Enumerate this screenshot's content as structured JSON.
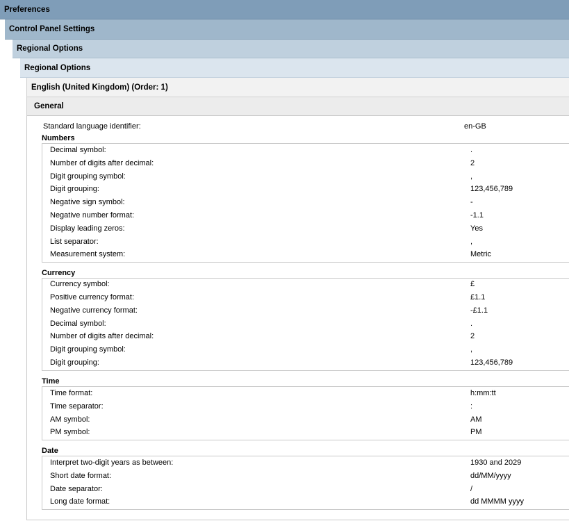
{
  "breadcrumb": {
    "level1": "Preferences",
    "level2": "Control Panel Settings",
    "level3": "Regional Options",
    "level4": "Regional Options",
    "level5": "English (United Kingdom) (Order: 1)",
    "level6": "General"
  },
  "standard_language": {
    "label": "Standard language identifier:",
    "value": "en-GB"
  },
  "sections": {
    "numbers": {
      "title": "Numbers",
      "rows": [
        {
          "label": "Decimal symbol:",
          "value": "."
        },
        {
          "label": "Number of digits after decimal:",
          "value": "2"
        },
        {
          "label": "Digit grouping symbol:",
          "value": ","
        },
        {
          "label": "Digit grouping:",
          "value": "123,456,789"
        },
        {
          "label": "Negative sign symbol:",
          "value": "-"
        },
        {
          "label": "Negative number format:",
          "value": "-1.1"
        },
        {
          "label": "Display leading zeros:",
          "value": "Yes"
        },
        {
          "label": "List separator:",
          "value": ","
        },
        {
          "label": "Measurement system:",
          "value": "Metric"
        }
      ]
    },
    "currency": {
      "title": "Currency",
      "rows": [
        {
          "label": "Currency symbol:",
          "value": "£"
        },
        {
          "label": "Positive currency format:",
          "value": "£1.1"
        },
        {
          "label": "Negative currency format:",
          "value": "-£1.1"
        },
        {
          "label": "Decimal symbol:",
          "value": "."
        },
        {
          "label": "Number of digits after decimal:",
          "value": "2"
        },
        {
          "label": "Digit grouping symbol:",
          "value": ","
        },
        {
          "label": "Digit grouping:",
          "value": "123,456,789"
        }
      ]
    },
    "time": {
      "title": "Time",
      "rows": [
        {
          "label": "Time format:",
          "value": "h:mm:tt"
        },
        {
          "label": "Time separator:",
          "value": ":"
        },
        {
          "label": "AM symbol:",
          "value": "AM"
        },
        {
          "label": "PM symbol:",
          "value": "PM"
        }
      ]
    },
    "date": {
      "title": "Date",
      "rows": [
        {
          "label": "Interpret two-digit years as between:",
          "value": "1930 and 2029"
        },
        {
          "label": "Short date format:",
          "value": "dd/MM/yyyy"
        },
        {
          "label": "Date separator:",
          "value": "/"
        },
        {
          "label": "Long date format:",
          "value": "dd MMMM yyyy"
        }
      ]
    }
  }
}
